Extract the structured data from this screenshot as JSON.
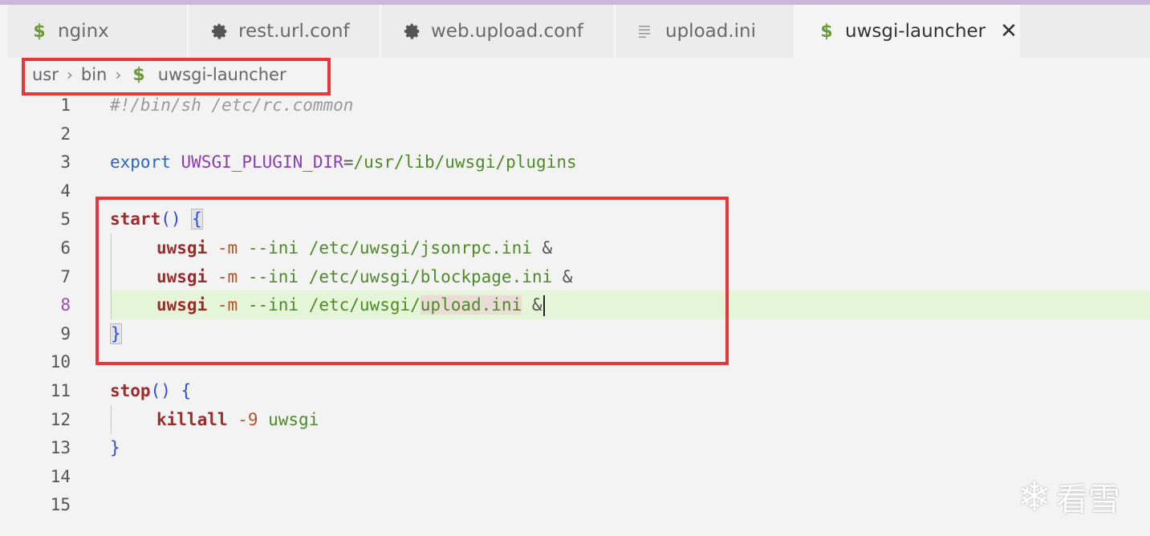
{
  "tabs": [
    {
      "label": "nginx",
      "icon": "dollar-icon",
      "active": false
    },
    {
      "label": "rest.url.conf",
      "icon": "gear-icon",
      "active": false
    },
    {
      "label": "web.upload.conf",
      "icon": "gear-icon",
      "active": false
    },
    {
      "label": "upload.ini",
      "icon": "lines-icon",
      "active": false
    },
    {
      "label": "uwsgi-launcher",
      "icon": "dollar-icon",
      "active": true
    }
  ],
  "tab_close": "✕",
  "breadcrumb": [
    "usr",
    "bin",
    "uwsgi-launcher"
  ],
  "breadcrumb_sep": "›",
  "dollar_glyph": "$",
  "line_numbers": [
    "1",
    "2",
    "3",
    "4",
    "5",
    "6",
    "7",
    "8",
    "9",
    "10",
    "11",
    "12",
    "13",
    "14",
    "15"
  ],
  "current_line": "8",
  "code": {
    "l1": "#!/bin/sh /etc/rc.common",
    "l3_kw": "export",
    "l3_var": "UWSGI_PLUGIN_DIR",
    "l3_eq": "=",
    "l3_val": "/usr/lib/uwsgi/plugins",
    "l5_fn": "start",
    "l5_paren": "()",
    "open_brace": "{",
    "close_brace": "}",
    "cmd_uwsgi": "uwsgi",
    "flag_m": "-m",
    "opt_ini": "--ini",
    "l6_path": "/etc/uwsgi/jsonrpc.ini",
    "l7_path": "/etc/uwsgi/blockpage.ini",
    "l8_path_a": "/etc/uwsgi/",
    "l8_path_b": "upload.ini",
    "amp": "&",
    "l11_fn": "stop",
    "l12_cmd": "killall",
    "l12_flag": "-9",
    "l12_arg": "uwsgi"
  },
  "watermark": {
    "text": "看雪",
    "icon": "snowflake-icon"
  },
  "colors": {
    "highlight_box": "#e8343a",
    "current_line_bg": "#e5f5d7",
    "keyword": "#2b67b8",
    "function": "#9c2b2b",
    "string": "#4e8a2a"
  }
}
